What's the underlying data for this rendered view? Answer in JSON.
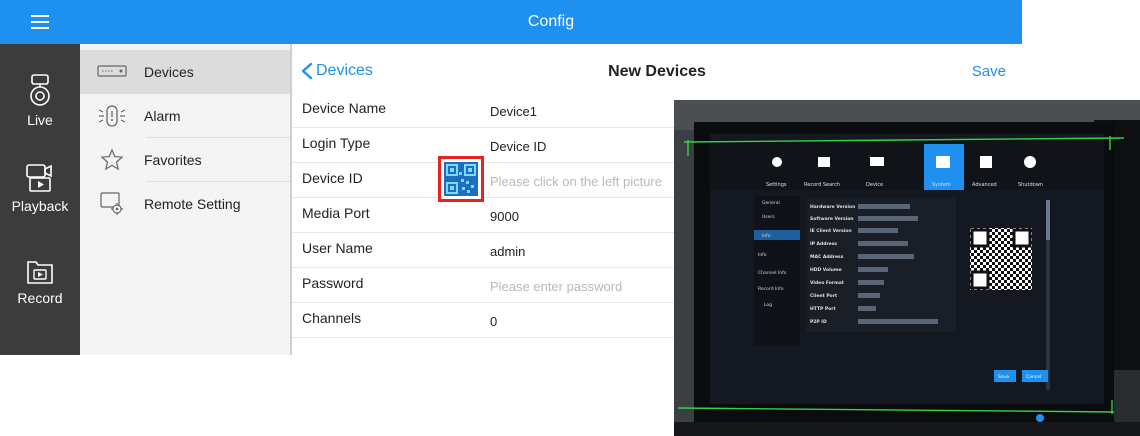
{
  "app": {
    "menu_icon": "hamburger-icon",
    "header_title": "Config"
  },
  "rail": {
    "items": [
      {
        "label": "Live",
        "icon": "camera-icon"
      },
      {
        "label": "Playback",
        "icon": "playback-video-icon"
      },
      {
        "label": "Record",
        "icon": "record-folder-icon"
      }
    ]
  },
  "menu": {
    "items": [
      {
        "label": "Devices",
        "icon": "dvr-device-icon",
        "active": true
      },
      {
        "label": "Alarm",
        "icon": "alarm-icon",
        "active": false
      },
      {
        "label": "Favorites",
        "icon": "star-icon",
        "active": false
      },
      {
        "label": "Remote Setting",
        "icon": "remote-setting-icon",
        "active": false
      }
    ]
  },
  "detail": {
    "back_label": "Devices",
    "title": "New Devices",
    "save_label": "Save",
    "fields": [
      {
        "label": "Device Name",
        "value": "Device1"
      },
      {
        "label": "Login Type",
        "value": "Device ID"
      },
      {
        "label": "Device ID",
        "placeholder": "Please click on the left picture"
      },
      {
        "label": "Media Port",
        "value": "9000"
      },
      {
        "label": "User Name",
        "value": "admin"
      },
      {
        "label": "Password",
        "placeholder": "Please enter password"
      },
      {
        "label": "Channels",
        "value": "0"
      }
    ]
  },
  "photo": {
    "toolbar": [
      "Settings",
      "Record Search",
      "Device",
      "System",
      "Advanced",
      "Shutdown"
    ],
    "sidebar": [
      "General",
      "Users",
      "Info",
      "Info",
      "Channel Info",
      "Record Info",
      "Log"
    ],
    "info_labels": [
      "Hardware Version",
      "Software Version",
      "IE Client Version",
      "IP Address",
      "MAC Address",
      "HDD Volume",
      "Video Format",
      "Client Port",
      "HTTP Port",
      "P2P ID"
    ],
    "buttons": [
      "Save",
      "Cancel"
    ],
    "colors": {
      "highlight": "#1e90f0",
      "scan_frame": "#36d14a"
    }
  },
  "colors": {
    "accent": "#1e90f0",
    "rail": "#3c3c3c",
    "highlight_box": "#e8231f"
  }
}
